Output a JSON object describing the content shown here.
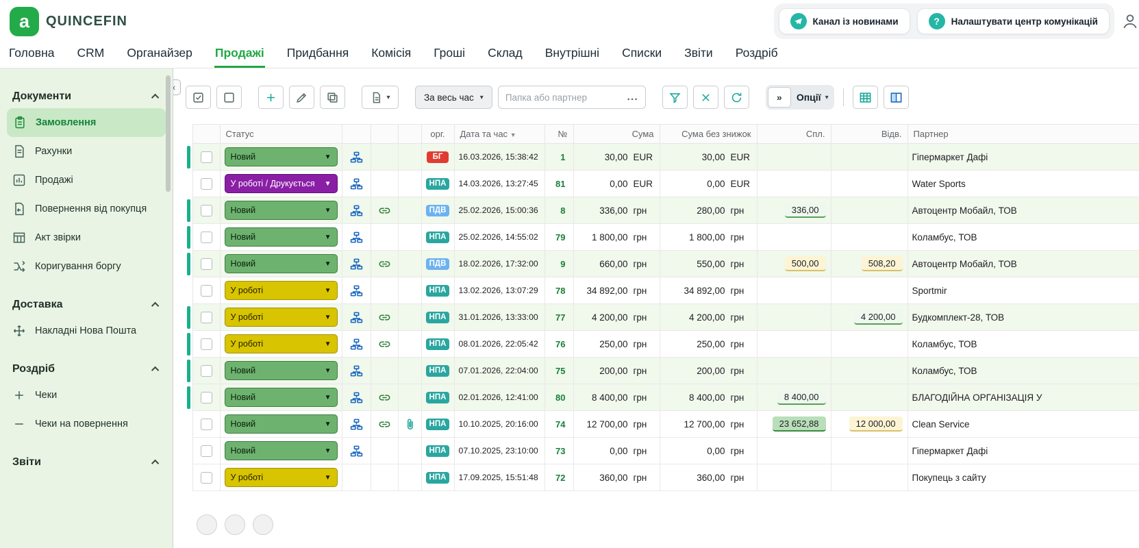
{
  "brand": {
    "name": "QUINCEFIN",
    "logo_letter": "a",
    "logo_color": "#23ab49"
  },
  "header": {
    "news_channel_label": "Канал із новинами",
    "comm_center_label": "Налаштувати центр комунікацій",
    "question_glyph": "?"
  },
  "nav": {
    "active": "Продажі",
    "tabs": [
      "Головна",
      "CRM",
      "Органайзер",
      "Продажі",
      "Придбання",
      "Комісія",
      "Гроші",
      "Склад",
      "Внутрішні",
      "Списки",
      "Звіти",
      "Роздріб"
    ]
  },
  "sidebar": {
    "sections": [
      {
        "title": "Документи",
        "items": [
          {
            "label": "Замовлення",
            "icon": "orders-icon",
            "active": true
          },
          {
            "label": "Рахунки",
            "icon": "invoices-icon"
          },
          {
            "label": "Продажі",
            "icon": "sales-chart-icon"
          },
          {
            "label": "Повернення від покупця",
            "icon": "return-icon"
          },
          {
            "label": "Акт звірки",
            "icon": "reconciliation-icon"
          },
          {
            "label": "Коригування боргу",
            "icon": "debt-adjustment-icon"
          }
        ]
      },
      {
        "title": "Доставка",
        "items": [
          {
            "label": "Накладні Нова Пошта",
            "icon": "nova-poshta-icon"
          }
        ]
      },
      {
        "title": "Роздріб",
        "items": [
          {
            "label": "Чеки",
            "icon": "plus-icon"
          },
          {
            "label": "Чеки на повернення",
            "icon": "minus-icon"
          }
        ]
      },
      {
        "title": "Звіти",
        "items": []
      }
    ],
    "collapse_glyph": "«"
  },
  "toolbar": {
    "period_filter_label": "За весь час",
    "search_placeholder": "Папка або партнер",
    "more_label": "...",
    "expand_glyph": "»",
    "options_label": "Опції"
  },
  "table": {
    "columns": [
      "Статус",
      "орг.",
      "Дата та час",
      "№",
      "Сума",
      "Сума без знижок",
      "Спл.",
      "Відв.",
      "Партнер"
    ],
    "rows": [
      {
        "status": "Новий",
        "status_type": "new",
        "org": true,
        "link": false,
        "attach": false,
        "badge": "БГ",
        "datetime": "16.03.2026, 15:38:42",
        "num": "1",
        "sum": "30,00",
        "sum_no_discount": "30,00",
        "currency": "EUR",
        "paid": "",
        "paid_style": "",
        "shipped": "",
        "shipped_style": "",
        "partner": "Гіпермаркет Дафі",
        "tint": true,
        "marker": true
      },
      {
        "status": "У роботі / Друкується",
        "status_type": "printing",
        "org": true,
        "link": false,
        "attach": false,
        "badge": "НПА",
        "datetime": "14.03.2026, 13:27:45",
        "num": "81",
        "sum": "0,00",
        "sum_no_discount": "0,00",
        "currency": "EUR",
        "paid": "",
        "paid_style": "",
        "shipped": "",
        "shipped_style": "",
        "partner": "Water Sports",
        "tint": false,
        "marker": false
      },
      {
        "status": "Новий",
        "status_type": "new",
        "org": true,
        "link": true,
        "attach": false,
        "badge": "ПДВ",
        "datetime": "25.02.2026, 15:00:36",
        "num": "8",
        "sum": "336,00",
        "sum_no_discount": "280,00",
        "currency": "грн",
        "paid": "336,00",
        "paid_style": "green",
        "shipped": "",
        "shipped_style": "",
        "partner": "Автоцентр Мобайл, ТОВ",
        "tint": true,
        "marker": true
      },
      {
        "status": "Новий",
        "status_type": "new",
        "org": true,
        "link": false,
        "attach": false,
        "badge": "НПА",
        "datetime": "25.02.2026, 14:55:02",
        "num": "79",
        "sum": "1 800,00",
        "sum_no_discount": "1 800,00",
        "currency": "грн",
        "paid": "",
        "paid_style": "",
        "shipped": "",
        "shipped_style": "",
        "partner": "Коламбус, ТОВ",
        "tint": false,
        "marker": true
      },
      {
        "status": "Новий",
        "status_type": "new",
        "org": true,
        "link": true,
        "attach": false,
        "badge": "ПДВ",
        "datetime": "18.02.2026, 17:32:00",
        "num": "9",
        "sum": "660,00",
        "sum_no_discount": "550,00",
        "currency": "грн",
        "paid": "500,00",
        "paid_style": "yellow",
        "shipped": "508,20",
        "shipped_style": "yellow",
        "partner": "Автоцентр Мобайл, ТОВ",
        "tint": true,
        "marker": true
      },
      {
        "status": "У роботі",
        "status_type": "in_progress",
        "org": true,
        "link": false,
        "attach": false,
        "badge": "НПА",
        "datetime": "13.02.2026, 13:07:29",
        "num": "78",
        "sum": "34 892,00",
        "sum_no_discount": "34 892,00",
        "currency": "грн",
        "paid": "",
        "paid_style": "",
        "shipped": "",
        "shipped_style": "",
        "partner": "Sportmir",
        "tint": false,
        "marker": false
      },
      {
        "status": "У роботі",
        "status_type": "in_progress",
        "org": true,
        "link": true,
        "attach": false,
        "badge": "НПА",
        "datetime": "31.01.2026, 13:33:00",
        "num": "77",
        "sum": "4 200,00",
        "sum_no_discount": "4 200,00",
        "currency": "грн",
        "paid": "",
        "paid_style": "",
        "shipped": "4 200,00",
        "shipped_style": "green",
        "partner": "Будкомплект-28, ТОВ",
        "tint": true,
        "marker": true
      },
      {
        "status": "У роботі",
        "status_type": "in_progress",
        "org": true,
        "link": true,
        "attach": false,
        "badge": "НПА",
        "datetime": "08.01.2026, 22:05:42",
        "num": "76",
        "sum": "250,00",
        "sum_no_discount": "250,00",
        "currency": "грн",
        "paid": "",
        "paid_style": "",
        "shipped": "",
        "shipped_style": "",
        "partner": "Коламбус, ТОВ",
        "tint": false,
        "marker": true
      },
      {
        "status": "Новий",
        "status_type": "new",
        "org": true,
        "link": false,
        "attach": false,
        "badge": "НПА",
        "datetime": "07.01.2026, 22:04:00",
        "num": "75",
        "sum": "200,00",
        "sum_no_discount": "200,00",
        "currency": "грн",
        "paid": "",
        "paid_style": "",
        "shipped": "",
        "shipped_style": "",
        "partner": "Коламбус, ТОВ",
        "tint": true,
        "marker": true
      },
      {
        "status": "Новий",
        "status_type": "new",
        "org": true,
        "link": true,
        "attach": false,
        "badge": "НПА",
        "datetime": "02.01.2026, 12:41:00",
        "num": "80",
        "sum": "8 400,00",
        "sum_no_discount": "8 400,00",
        "currency": "грн",
        "paid": "8 400,00",
        "paid_style": "green",
        "shipped": "",
        "shipped_style": "",
        "partner": "БЛАГОДІЙНА ОРГАНІЗАЦІЯ У",
        "tint": true,
        "marker": true
      },
      {
        "status": "Новий",
        "status_type": "new",
        "org": true,
        "link": true,
        "attach": true,
        "badge": "НПА",
        "datetime": "10.10.2025, 20:16:00",
        "num": "74",
        "sum": "12 700,00",
        "sum_no_discount": "12 700,00",
        "currency": "грн",
        "paid": "23 652,88",
        "paid_style": "green_strong",
        "shipped": "12 000,00",
        "shipped_style": "yellow",
        "partner": "Clean Service",
        "tint": false,
        "marker": false
      },
      {
        "status": "Новий",
        "status_type": "new",
        "org": true,
        "link": false,
        "attach": false,
        "badge": "НПА",
        "datetime": "07.10.2025, 23:10:00",
        "num": "73",
        "sum": "0,00",
        "sum_no_discount": "0,00",
        "currency": "грн",
        "paid": "",
        "paid_style": "",
        "shipped": "",
        "shipped_style": "",
        "partner": "Гіпермаркет Дафі",
        "tint": false,
        "marker": false
      },
      {
        "status": "У роботі",
        "status_type": "in_progress",
        "org": false,
        "link": false,
        "attach": false,
        "badge": "НПА",
        "datetime": "17.09.2025, 15:51:48",
        "num": "72",
        "sum": "360,00",
        "sum_no_discount": "360,00",
        "currency": "грн",
        "paid": "",
        "paid_style": "",
        "shipped": "",
        "shipped_style": "",
        "partner": "Покупець з сайту",
        "tint": false,
        "marker": false
      }
    ]
  },
  "colors": {
    "accent_green": "#21a745",
    "sidebar_bg": "#e9f4e4",
    "marker": "#17b08e",
    "status": {
      "new": {
        "bg": "#6db36f",
        "border": "#3e7d41",
        "text": "#0c1f0c"
      },
      "in_progress": {
        "bg": "#d8c400",
        "border": "#a09200",
        "text": "#201c00"
      },
      "printing": {
        "bg": "#8a1fa6",
        "border": "#5e1273",
        "text": "#ffffff"
      }
    },
    "badges": {
      "БГ": "#e03c31",
      "НПА": "#2aa6a0",
      "ПДВ": "#6cb2f0"
    },
    "chips": {
      "green": {
        "bg": "#eef8ee",
        "border": "#57a05a"
      },
      "green_strong": {
        "bg": "#b9dfba",
        "border": "#3a8a3e"
      },
      "yellow": {
        "bg": "#fcf4d4",
        "border": "#d8c169"
      }
    }
  }
}
